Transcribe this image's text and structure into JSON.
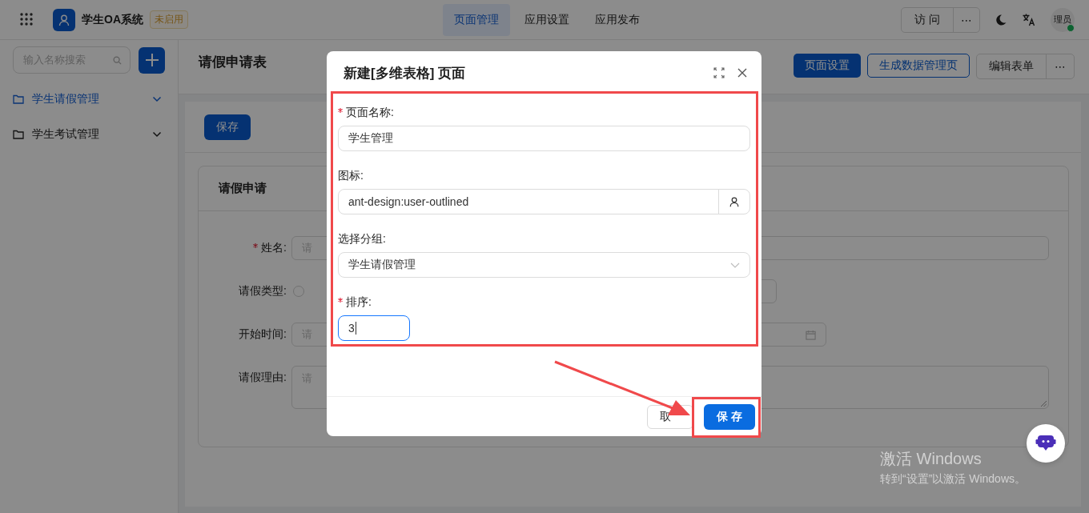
{
  "top_bar": {
    "app_name": "学生OA系统",
    "status_badge": "未启用",
    "nav_tabs": [
      {
        "label": "页面管理",
        "selected": true
      },
      {
        "label": "应用设置",
        "selected": false
      },
      {
        "label": "应用发布",
        "selected": false
      }
    ],
    "visit_button": "访 问",
    "more_button": "⋯",
    "avatar_text": "理员",
    "online": true
  },
  "sidebar": {
    "search_placeholder": "输入名称搜索",
    "groups": [
      {
        "label": "学生请假管理",
        "selected": true
      },
      {
        "label": "学生考试管理",
        "selected": false
      }
    ]
  },
  "page": {
    "title": "请假申请表",
    "actions": [
      {
        "label": "页面设置",
        "kind": "primary"
      },
      {
        "label": "生成数据管理页",
        "kind": "outline"
      },
      {
        "label": "编辑表单",
        "kind": "default"
      }
    ],
    "more_button": "⋯",
    "save_button": "保存",
    "form": {
      "title": "请假申请",
      "fields": [
        {
          "label": "姓名:",
          "required": true,
          "kind": "input",
          "placeholder": "请"
        },
        {
          "label": "请假类型:",
          "required": false,
          "kind": "radio",
          "checked": false
        },
        {
          "label": "开始时间:",
          "required": false,
          "kind": "date",
          "placeholder": "请"
        },
        {
          "label": "请假理由:",
          "required": false,
          "kind": "textarea",
          "placeholder": "请"
        }
      ]
    }
  },
  "dialog": {
    "title": "新建[多维表格] 页面",
    "fields": [
      {
        "label": "页面名称:",
        "required": true,
        "kind": "text",
        "value": "学生管理",
        "focused": false
      },
      {
        "label": "图标:",
        "required": false,
        "kind": "icon",
        "value": "ant-design:user-outlined",
        "focused": false
      },
      {
        "label": "选择分组:",
        "required": false,
        "kind": "select",
        "value": "学生请假管理",
        "focused": false
      },
      {
        "label": "排序:",
        "required": true,
        "kind": "number",
        "value": "3",
        "focused": true
      }
    ],
    "cancel_button": "取",
    "ok_button": "保 存"
  },
  "os_notice": {
    "title": "激活 Windows",
    "message": "转到“设置”以激活 Windows。"
  },
  "annotations": {
    "form_frame": true,
    "save_frame": true,
    "arrow": true
  }
}
